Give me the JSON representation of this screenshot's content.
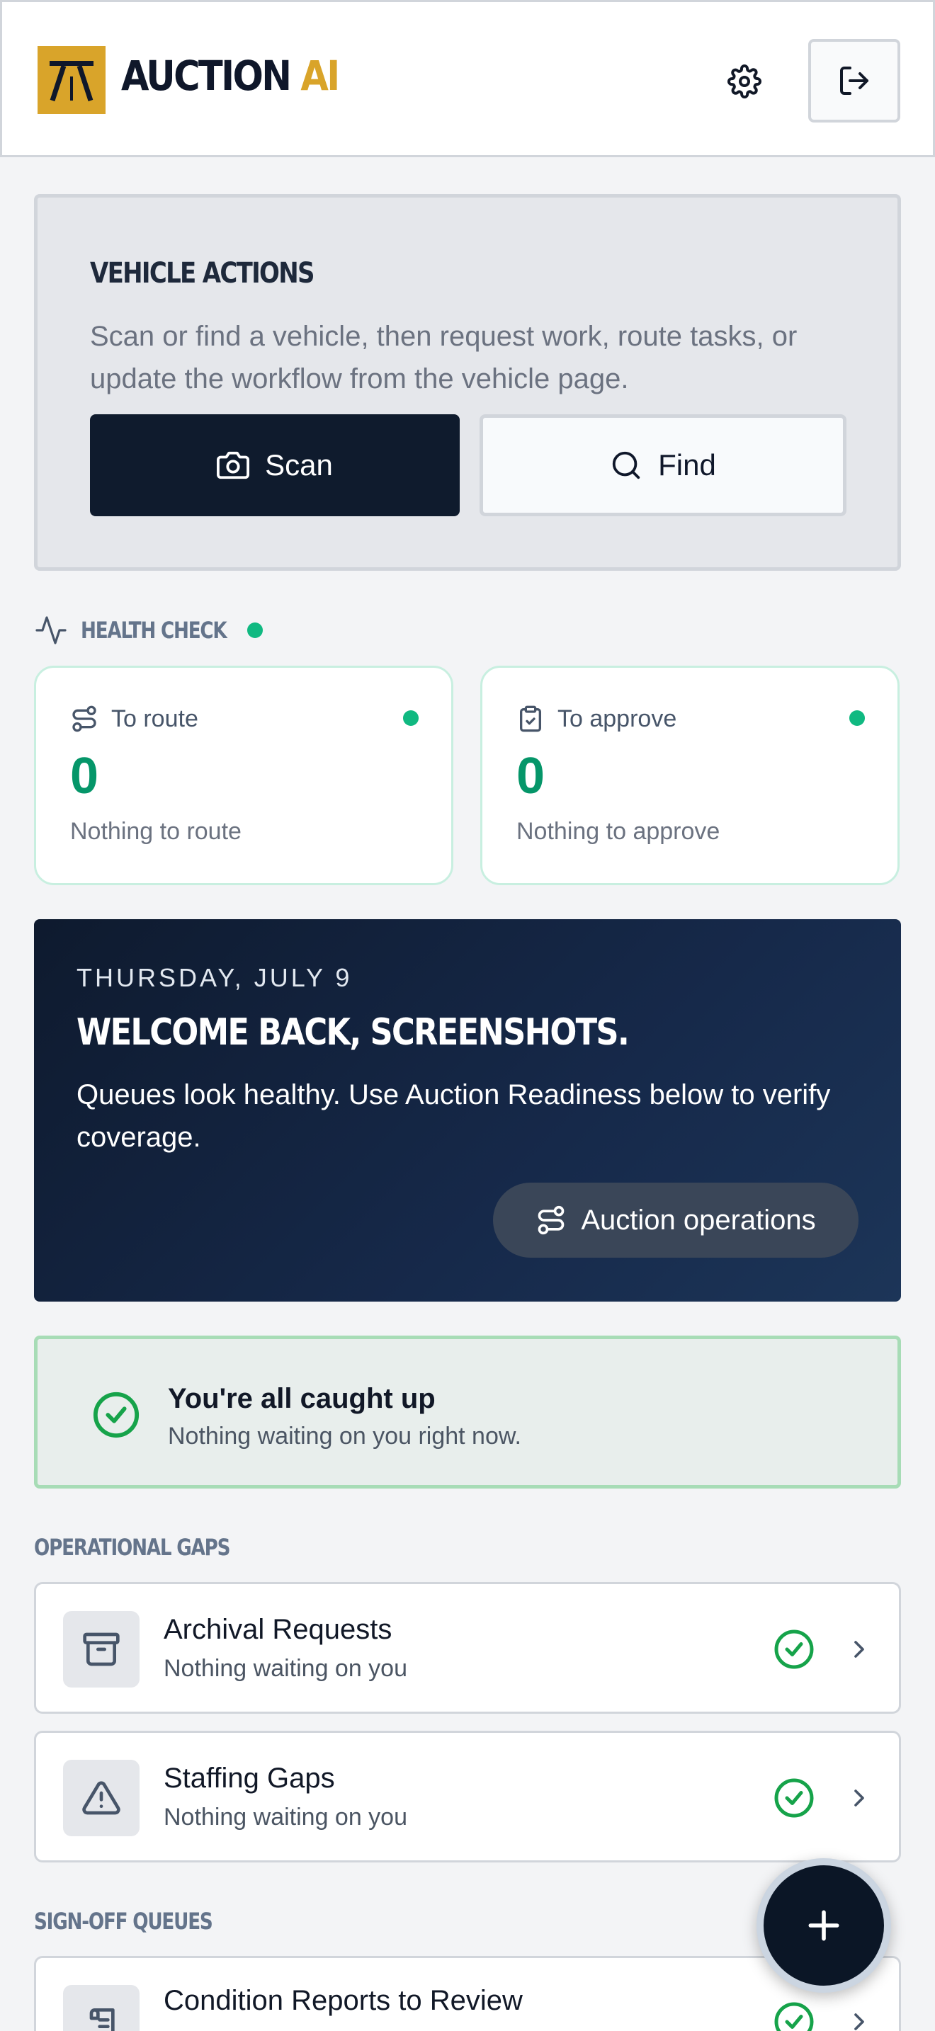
{
  "header": {
    "brand_main": "AUCTION",
    "brand_accent": "AI",
    "settings_icon": "gear-icon",
    "logout_icon": "logout-icon"
  },
  "vehicle_actions": {
    "title": "VEHICLE ACTIONS",
    "description": "Scan or find a vehicle, then request work, route tasks, or update the workflow from the vehicle page.",
    "scan_label": "Scan",
    "find_label": "Find"
  },
  "health_check": {
    "label": "HEALTH CHECK",
    "cards": [
      {
        "title": "To route",
        "count": "0",
        "subtitle": "Nothing to route",
        "icon": "route-icon"
      },
      {
        "title": "To approve",
        "count": "0",
        "subtitle": "Nothing to approve",
        "icon": "clipboard-check-icon"
      }
    ]
  },
  "welcome": {
    "date": "THURSDAY, JULY 9",
    "title": "WELCOME BACK, SCREENSHOTS.",
    "message": "Queues look healthy. Use Auction Readiness below to verify coverage.",
    "button_label": "Auction operations"
  },
  "caught_up": {
    "title": "You're all caught up",
    "subtitle": "Nothing waiting on you right now."
  },
  "operational_gaps": {
    "label": "OPERATIONAL GAPS",
    "items": [
      {
        "title": "Archival Requests",
        "subtitle": "Nothing waiting on you",
        "icon": "archive-icon"
      },
      {
        "title": "Staffing Gaps",
        "subtitle": "Nothing waiting on you",
        "icon": "warning-icon"
      }
    ]
  },
  "signoff_queues": {
    "label": "SIGN-OFF QUEUES",
    "items": [
      {
        "title": "Condition Reports to Review",
        "icon": "report-icon"
      }
    ]
  },
  "colors": {
    "brand_gold": "#d9a42a",
    "navy": "#0f1b2d",
    "success": "#10b981"
  }
}
